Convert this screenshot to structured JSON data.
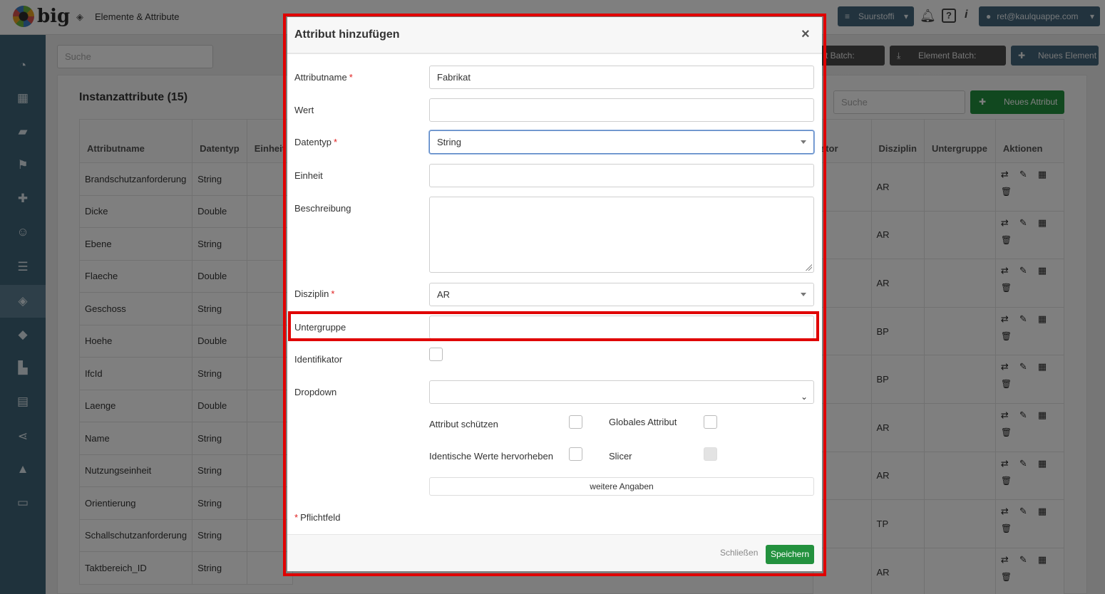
{
  "app": {
    "logo_text": "big",
    "breadcrumb": "Elemente & Attribute",
    "project_label": "Suurstoffi",
    "info_label": "i",
    "help_label": "?",
    "user_label": "ret@kaulquappe.com"
  },
  "sidebar": {
    "icons": [
      "dashboard-icon",
      "grid-icon",
      "book-icon",
      "flag-icon",
      "puzzle-icon",
      "users-icon",
      "database-icon",
      "layers-icon",
      "tags-icon",
      "layout-icon",
      "table-icon",
      "share-icon",
      "warning-icon",
      "card-icon"
    ],
    "active_index": 7
  },
  "page": {
    "search_placeholder": "Suche",
    "batch_export_label": "t Batch: Export",
    "batch_import_label": "Element Batch: Import",
    "new_element_label": "Neues Element",
    "panel_title": "Instanzattribute (15)",
    "attr_search_placeholder": "Suche",
    "new_attr_label": "Neues Attribut"
  },
  "left_table": {
    "headers": [
      "Attributname",
      "Datentyp",
      "Einheit"
    ],
    "rows": [
      [
        "Brandschutzanforderung",
        "String"
      ],
      [
        "Dicke",
        "Double"
      ],
      [
        "Ebene",
        "String"
      ],
      [
        "Flaeche",
        "Double"
      ],
      [
        "Geschoss",
        "String"
      ],
      [
        "Hoehe",
        "Double"
      ],
      [
        "IfcId",
        "String"
      ],
      [
        "Laenge",
        "Double"
      ],
      [
        "Name",
        "String"
      ],
      [
        "Nutzungseinheit",
        "String"
      ],
      [
        "Orientierung",
        "String"
      ],
      [
        "Schallschutzanforderung",
        "String"
      ],
      [
        "Taktbereich_ID",
        "String"
      ]
    ]
  },
  "right_table": {
    "headers": [
      "ator",
      "Disziplin",
      "Untergruppe",
      "Aktionen"
    ],
    "disciplines": [
      "AR",
      "AR",
      "AR",
      "BP",
      "BP",
      "AR",
      "AR",
      "TP",
      "AR"
    ]
  },
  "modal": {
    "title": "Attribut hinzufügen",
    "close_icon": "×",
    "fields": {
      "name_label": "Attributname",
      "name_value": "Fabrikat",
      "value_label": "Wert",
      "value_value": "",
      "type_label": "Datentyp",
      "type_value": "String",
      "unit_label": "Einheit",
      "unit_value": "",
      "desc_label": "Beschreibung",
      "discipline_label": "Disziplin",
      "discipline_value": "AR",
      "subgroup_label": "Untergruppe",
      "subgroup_value": "",
      "identifier_label": "Identifikator",
      "dropdown_label": "Dropdown",
      "dropdown_value": "",
      "protect_label": "Attribut schützen",
      "global_label": "Globales Attribut",
      "highlight_label": "Identische Werte hervorheben",
      "slicer_label": "Slicer",
      "more_label": "weitere Angaben",
      "required_note": "Pflichtfeld",
      "required_mark": "*"
    },
    "footer": {
      "close_label": "Schließen",
      "save_label": "Speichern"
    }
  },
  "colors": {
    "highlight": "#e00000",
    "save_green": "#23913e",
    "sidebar": "#3f6478"
  }
}
